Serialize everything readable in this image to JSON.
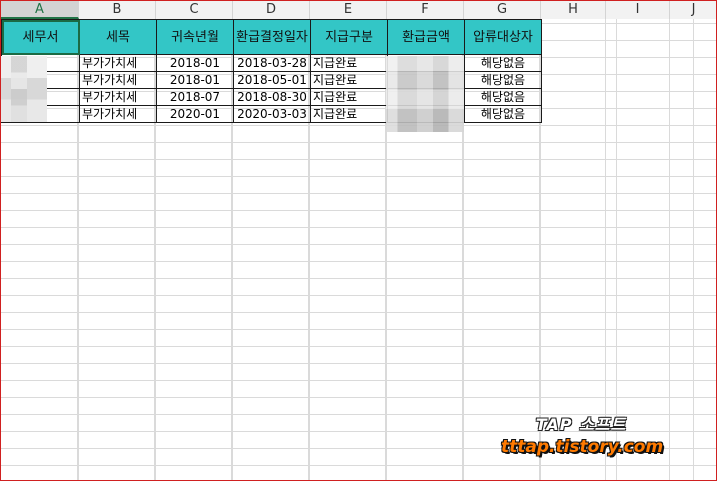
{
  "columns": [
    "A",
    "B",
    "C",
    "D",
    "E",
    "F",
    "G",
    "H",
    "I",
    "J"
  ],
  "active_column": "A",
  "table": {
    "headers": [
      "세무서",
      "세목",
      "귀속년월",
      "환급결정일자",
      "지급구분",
      "환급금액",
      "압류대상자"
    ],
    "rows": [
      [
        "",
        "부가가치세",
        "2018-01",
        "2018-03-28",
        "지급완료",
        "",
        "해당없음"
      ],
      [
        "",
        "부가가치세",
        "2018-01",
        "2018-05-01",
        "지급완료",
        "",
        "해당없음"
      ],
      [
        "",
        "부가가치세",
        "2018-07",
        "2018-08-30",
        "지급완료",
        "",
        "해당없음"
      ],
      [
        "",
        "부가가치세",
        "2020-01",
        "2020-03-03",
        "지급완료",
        "",
        "해당없음"
      ]
    ]
  },
  "watermark": {
    "title": "TAP 소프트",
    "url": "tttap.tistory.com"
  },
  "colors": {
    "header_fill": "#33c6c6",
    "grid_line": "#dadada",
    "border": "#1a1a1a",
    "watermark_url": "#ff7a00"
  }
}
